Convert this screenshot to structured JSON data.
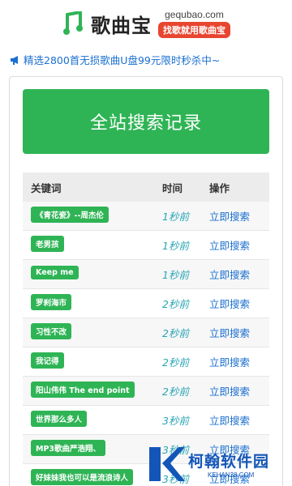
{
  "header": {
    "brand": "歌曲宝",
    "domain": "gequbao.com",
    "tagline": "找歌就用歌曲宝"
  },
  "promo": {
    "text": "精选2800首无损歌曲U盘99元限时秒杀中~",
    "icon": "megaphone-icon"
  },
  "main": {
    "button_label": "全站搜索记录"
  },
  "table": {
    "headers": [
      "关键词",
      "时间",
      "操作"
    ],
    "rows": [
      {
        "keyword": "《青花瓷》--周杰伦",
        "time": "1秒前",
        "action": "立即搜索"
      },
      {
        "keyword": "老男孩",
        "time": "1秒前",
        "action": "立即搜索"
      },
      {
        "keyword": "Keep me",
        "time": "1秒前",
        "action": "立即搜索"
      },
      {
        "keyword": "罗刹海市",
        "time": "2秒前",
        "action": "立即搜索"
      },
      {
        "keyword": "习性不改",
        "time": "2秒前",
        "action": "立即搜索"
      },
      {
        "keyword": "我记得",
        "time": "2秒前",
        "action": "立即搜索"
      },
      {
        "keyword": "阳山伟伟 The end point",
        "time": "2秒前",
        "action": "立即搜索"
      },
      {
        "keyword": "世界那么多人",
        "time": "3秒前",
        "action": "立即搜索"
      },
      {
        "keyword": "MP3歌曲严浩翔、",
        "time": "3秒前",
        "action": "立即搜索"
      },
      {
        "keyword": "好妹妹我也可以是流浪诗人",
        "time": "3秒前",
        "action": "立即搜索"
      }
    ]
  },
  "watermark": {
    "name": "柯翰软件园",
    "url": "KEHAN38.COM"
  },
  "colors": {
    "green": "#2fb455",
    "link_blue": "#1a6fd0",
    "time_teal": "#2aa5b5",
    "tagline_red": "#e84530"
  }
}
